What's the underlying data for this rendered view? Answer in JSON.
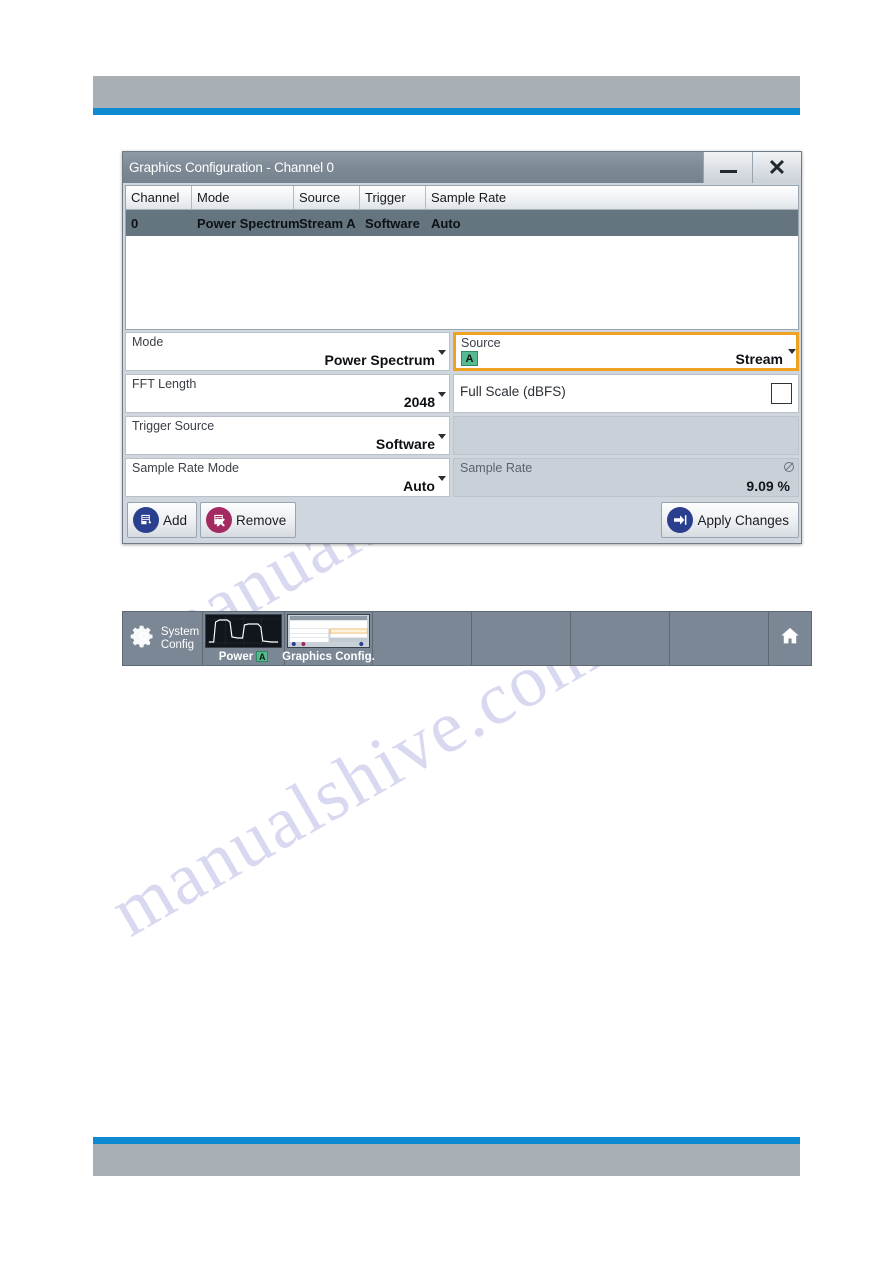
{
  "page": {
    "header_band_color": "#a8afb5",
    "header_rule_color": "#0d8ad1",
    "watermark_lines": [
      "manualshive.com",
      "manualshive.com"
    ]
  },
  "dialog": {
    "title": "Graphics Configuration - Channel 0",
    "window_controls": {
      "minimize": {
        "name": "minimize-button",
        "glyph": "—"
      },
      "close": {
        "name": "close-button",
        "glyph": "✕"
      }
    },
    "table": {
      "columns": [
        "Channel",
        "Mode",
        "Source",
        "Trigger",
        "Sample Rate"
      ],
      "rows": [
        {
          "channel": "0",
          "mode": "Power Spectrum",
          "source": "Stream A",
          "trigger": "Software",
          "sample_rate": "Auto"
        }
      ]
    },
    "fields_left": [
      {
        "label": "Mode",
        "value": "Power Spectrum",
        "control": "dropdown"
      },
      {
        "label": "FFT Length",
        "value": "2048",
        "control": "dropdown"
      },
      {
        "label": "Trigger Source",
        "value": "Software",
        "control": "dropdown"
      },
      {
        "label": "Sample Rate Mode",
        "value": "Auto",
        "control": "dropdown"
      }
    ],
    "fields_right": {
      "source": {
        "label": "Source",
        "value": "Stream",
        "badge": "A",
        "badge_color": "#57b98f",
        "highlight_color": "#f0a323",
        "control": "dropdown"
      },
      "full_scale": {
        "label": "Full Scale (dBFS)",
        "checked": false,
        "control": "checkbox"
      },
      "sample_rate": {
        "label": "Sample Rate",
        "value": "9.09 %",
        "state": "read-only",
        "control": "readonly-field"
      }
    },
    "buttons": {
      "add": {
        "label": "Add",
        "icon": "add-document-icon",
        "icon_color": "#2b3f8f"
      },
      "remove": {
        "label": "Remove",
        "icon": "remove-document-icon",
        "icon_color": "#a32b62"
      },
      "apply": {
        "label": "Apply Changes",
        "icon": "arrow-right-icon",
        "icon_color": "#2b3f8f"
      }
    }
  },
  "taskbar": {
    "system_config": {
      "label_line1": "System",
      "label_line2": "Config",
      "icon": "gear-icon"
    },
    "tasks": [
      {
        "caption": "Power",
        "badge": "A",
        "thumb": "power-spectrum-chart"
      },
      {
        "caption": "Graphics Config.",
        "badge": "",
        "thumb": "dialog-preview"
      }
    ],
    "empty_slots": 4,
    "home": {
      "icon": "home-icon"
    }
  }
}
